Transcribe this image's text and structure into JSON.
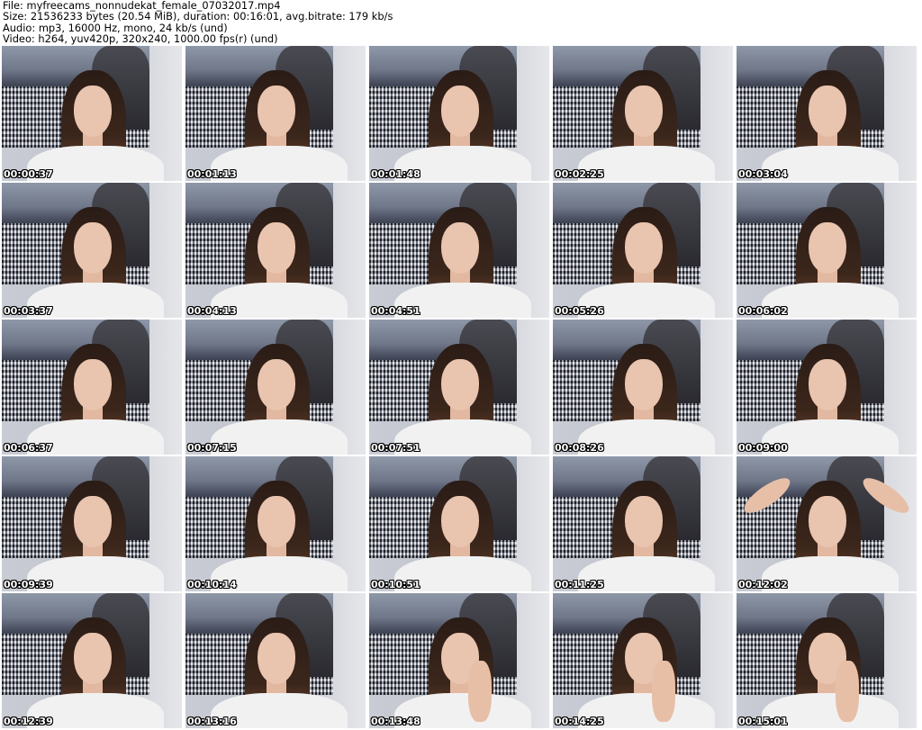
{
  "header": {
    "line1": "File: myfreecams_nonnudekat_female_07032017.mp4",
    "line2": "Size: 21536233 bytes (20.54 MiB), duration: 00:16:01, avg.bitrate: 179 kb/s",
    "line3": "Audio: mp3, 16000 Hz, mono, 24 kb/s (und)",
    "line4": "Video: h264, yuv420p, 320x240, 1000.00 fps(r) (und)"
  },
  "thumbnails": [
    {
      "timestamp": "00:00:37"
    },
    {
      "timestamp": "00:01:13"
    },
    {
      "timestamp": "00:01:48"
    },
    {
      "timestamp": "00:02:25"
    },
    {
      "timestamp": "00:03:04"
    },
    {
      "timestamp": "00:03:37"
    },
    {
      "timestamp": "00:04:13"
    },
    {
      "timestamp": "00:04:51"
    },
    {
      "timestamp": "00:05:26"
    },
    {
      "timestamp": "00:06:02"
    },
    {
      "timestamp": "00:06:37"
    },
    {
      "timestamp": "00:07:15"
    },
    {
      "timestamp": "00:07:51"
    },
    {
      "timestamp": "00:08:26"
    },
    {
      "timestamp": "00:09:00"
    },
    {
      "timestamp": "00:09:39"
    },
    {
      "timestamp": "00:10:14"
    },
    {
      "timestamp": "00:10:51"
    },
    {
      "timestamp": "00:11:25"
    },
    {
      "timestamp": "00:12:02"
    },
    {
      "timestamp": "00:12:39"
    },
    {
      "timestamp": "00:13:16"
    },
    {
      "timestamp": "00:13:48"
    },
    {
      "timestamp": "00:14:25"
    },
    {
      "timestamp": "00:15:01"
    }
  ]
}
